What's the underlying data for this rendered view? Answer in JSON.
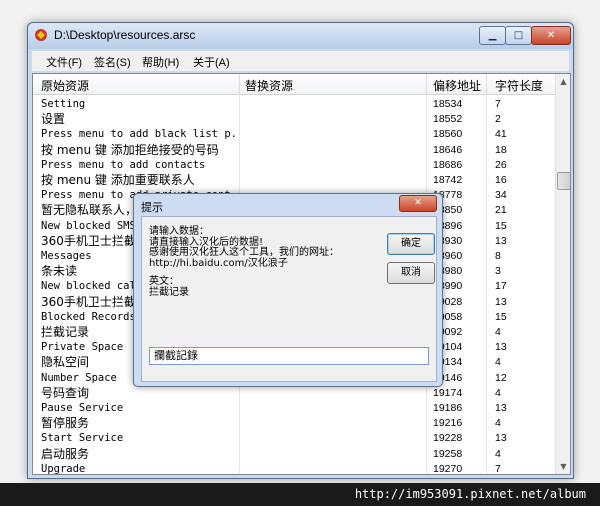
{
  "window": {
    "title": "D:\\Desktop\\resources.arsc",
    "min_glyph": "▁",
    "max_glyph": "□",
    "close_glyph": "✕"
  },
  "menu": [
    "文件(F)",
    "签名(S)",
    "帮助(H)",
    "关于(A)"
  ],
  "table": {
    "headers": [
      "原始资源",
      "替换资源",
      "偏移地址",
      "字符长度"
    ],
    "rows": [
      {
        "original": "Setting",
        "offset": "18534",
        "length": "7"
      },
      {
        "original": "设置",
        "offset": "18552",
        "length": "2"
      },
      {
        "original": "Press menu to add black list p...",
        "offset": "18560",
        "length": "41"
      },
      {
        "original": "按 menu 键 添加拒绝接受的号码",
        "offset": "18646",
        "length": "18"
      },
      {
        "original": "Press menu to add contacts",
        "offset": "18686",
        "length": "26"
      },
      {
        "original": "按 menu 键 添加重要联系人",
        "offset": "18742",
        "length": "16"
      },
      {
        "original": "Press menu to add private cont...",
        "offset": "18778",
        "length": "34"
      },
      {
        "original": "暂无隐私联系人，",
        "offset": "18850",
        "length": "21"
      },
      {
        "original": "New blocked SMS",
        "offset": "18896",
        "length": "15"
      },
      {
        "original": "360手机卫士拦截到",
        "offset": "18930",
        "length": "13"
      },
      {
        "original": "Messages",
        "offset": "18960",
        "length": "8"
      },
      {
        "original": "条未读",
        "offset": "18980",
        "length": "3"
      },
      {
        "original": "New blocked call",
        "offset": "18990",
        "length": "17"
      },
      {
        "original": "360手机卫士拦截到",
        "offset": "19028",
        "length": "13"
      },
      {
        "original": "Blocked Records",
        "offset": "19058",
        "length": "15"
      },
      {
        "original": "拦截记录",
        "offset": "19092",
        "length": "4"
      },
      {
        "original": "Private Space",
        "offset": "19104",
        "length": "13"
      },
      {
        "original": "隐私空间",
        "offset": "19134",
        "length": "4"
      },
      {
        "original": "Number Space",
        "offset": "19146",
        "length": "12"
      },
      {
        "original": "号码查询",
        "offset": "19174",
        "length": "4"
      },
      {
        "original": "Pause Service",
        "offset": "19186",
        "length": "13"
      },
      {
        "original": "暂停服务",
        "offset": "19216",
        "length": "4"
      },
      {
        "original": "Start Service",
        "offset": "19228",
        "length": "13"
      },
      {
        "original": "启动服务",
        "offset": "19258",
        "length": "4"
      },
      {
        "original": "Upgrade",
        "offset": "19270",
        "length": "7"
      }
    ]
  },
  "dialog": {
    "title": "提示",
    "message_lines": [
      "请输入数据：",
      "请直接输入汉化后的数据!",
      "感谢使用汉化狂人这个工具，我们的网址：",
      "http://hi.baidu.com/汉化浪子",
      "",
      "英文：",
      "拦截记录"
    ],
    "ok_label": "确定",
    "cancel_label": "取消",
    "input_value": "攔截記錄",
    "close_glyph": "✕"
  },
  "footer": {
    "url": "http://im953091.pixnet.net/album"
  }
}
